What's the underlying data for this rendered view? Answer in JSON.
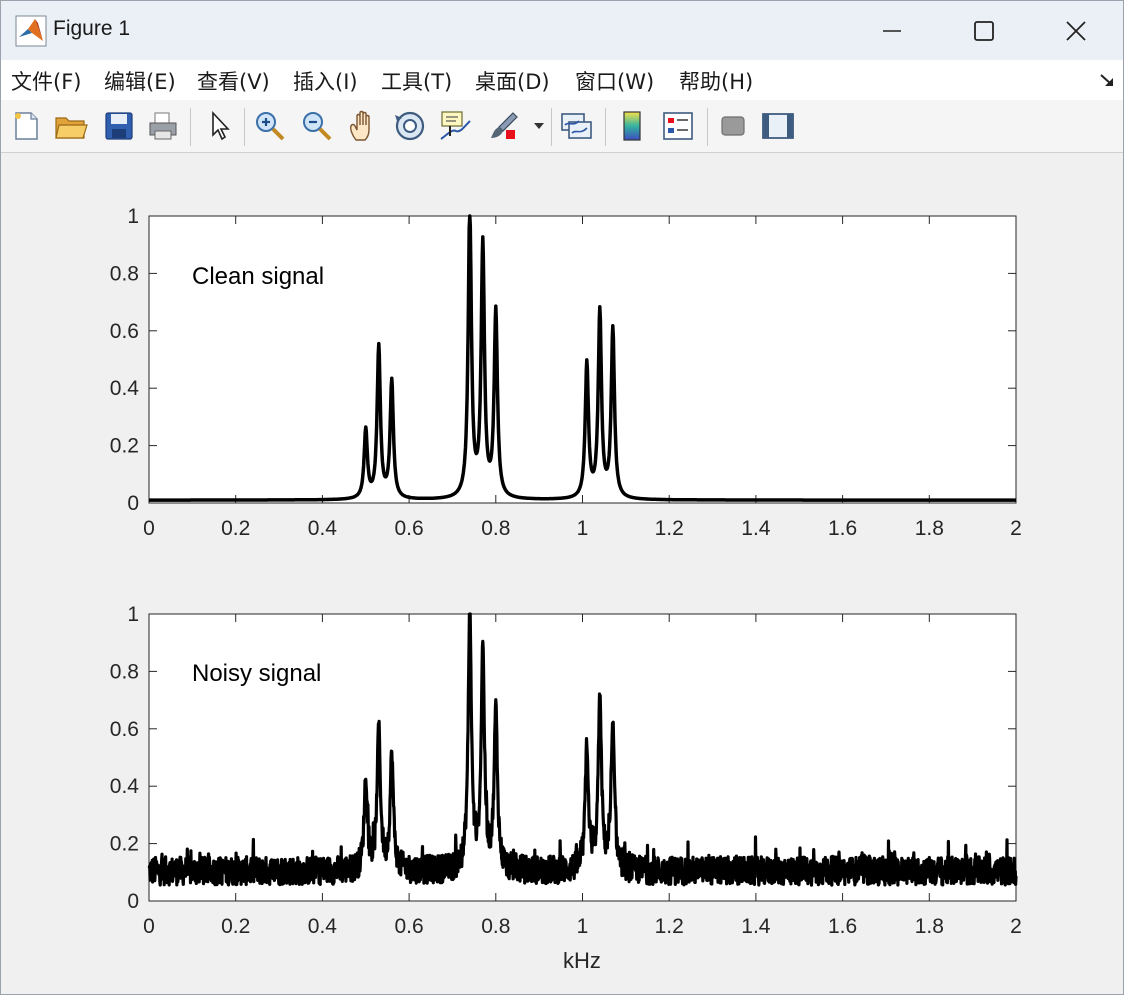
{
  "window": {
    "title": "Figure 1",
    "controls": [
      "minimize",
      "maximize",
      "close"
    ]
  },
  "menu": [
    {
      "label": "文件(F)"
    },
    {
      "label": "编辑(E)"
    },
    {
      "label": "查看(V)"
    },
    {
      "label": "插入(I)"
    },
    {
      "label": "工具(T)"
    },
    {
      "label": "桌面(D)"
    },
    {
      "label": "窗口(W)"
    },
    {
      "label": "帮助(H)"
    }
  ],
  "toolbar": {
    "icons": [
      "new-figure-icon",
      "open-file-icon",
      "save-icon",
      "print-icon",
      "select-arrow-icon",
      "zoom-in-icon",
      "zoom-out-icon",
      "pan-hand-icon",
      "rotate-3d-icon",
      "data-cursor-icon",
      "brush-icon",
      "brush-dropdown-icon",
      "link-plot-icon",
      "colorbar-icon",
      "legend-icon",
      "hide-plot-tools-icon",
      "show-plot-tools-icon"
    ]
  },
  "chart_data": [
    {
      "type": "line",
      "annotation": "Clean signal",
      "xlabel": "",
      "ylabel": "",
      "xlim": [
        0,
        2
      ],
      "ylim": [
        0,
        1
      ],
      "xticks": [
        "0",
        "0.2",
        "0.4",
        "0.6",
        "0.8",
        "1",
        "1.2",
        "1.4",
        "1.6",
        "1.8",
        "2"
      ],
      "yticks": [
        "0",
        "0.2",
        "0.4",
        "0.6",
        "0.8",
        "1"
      ],
      "color": "#000000",
      "peaks": [
        {
          "x": 0.5,
          "y": 0.24
        },
        {
          "x": 0.53,
          "y": 0.53
        },
        {
          "x": 0.56,
          "y": 0.41
        },
        {
          "x": 0.74,
          "y": 1.0
        },
        {
          "x": 0.77,
          "y": 0.88
        },
        {
          "x": 0.8,
          "y": 0.65
        },
        {
          "x": 1.01,
          "y": 0.47
        },
        {
          "x": 1.04,
          "y": 0.65
        },
        {
          "x": 1.07,
          "y": 0.59
        }
      ],
      "baseline": 0.01
    },
    {
      "type": "line",
      "annotation": "Noisy signal",
      "xlabel": "kHz",
      "ylabel": "",
      "xlim": [
        0,
        2
      ],
      "ylim": [
        0,
        1
      ],
      "xticks": [
        "0",
        "0.2",
        "0.4",
        "0.6",
        "0.8",
        "1",
        "1.2",
        "1.4",
        "1.6",
        "1.8",
        "2"
      ],
      "yticks": [
        "0",
        "0.2",
        "0.4",
        "0.6",
        "0.8",
        "1"
      ],
      "color": "#000000",
      "peaks": [
        {
          "x": 0.5,
          "y": 0.36
        },
        {
          "x": 0.53,
          "y": 0.56
        },
        {
          "x": 0.56,
          "y": 0.45
        },
        {
          "x": 0.74,
          "y": 1.0
        },
        {
          "x": 0.77,
          "y": 0.86
        },
        {
          "x": 0.8,
          "y": 0.63
        },
        {
          "x": 1.01,
          "y": 0.48
        },
        {
          "x": 1.04,
          "y": 0.67
        },
        {
          "x": 1.07,
          "y": 0.56
        }
      ],
      "noise_floor": [
        0.0,
        0.22
      ]
    }
  ]
}
